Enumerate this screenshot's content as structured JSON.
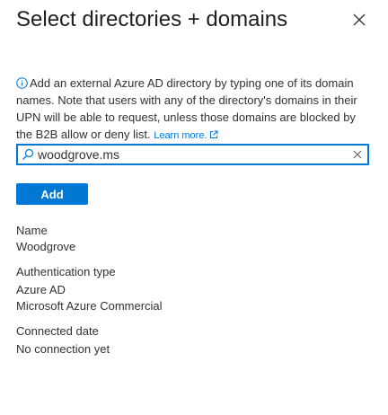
{
  "panel": {
    "title": "Select directories + domains"
  },
  "info": {
    "text": "Add an external Azure AD directory by typing one of its domain names. Note that users with any of the directory's domains in their UPN will be able to request, unless those domains are blocked by the B2B allow or deny list.",
    "learn_more": "Learn more."
  },
  "search": {
    "value": "woodgrove.ms"
  },
  "add_button": {
    "label": "Add"
  },
  "details": {
    "name_label": "Name",
    "name_value": "Woodgrove",
    "auth_label": "Authentication type",
    "auth_value_1": "Azure AD",
    "auth_value_2": "Microsoft Azure Commercial",
    "connected_label": "Connected date",
    "connected_value": "No connection yet"
  },
  "colors": {
    "accent": "#0078d4",
    "text": "#323130"
  }
}
